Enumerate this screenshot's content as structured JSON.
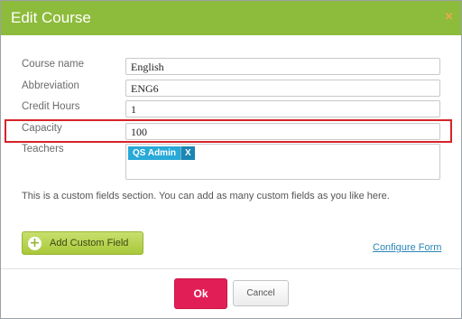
{
  "dialog": {
    "title": "Edit Course",
    "close_glyph": "×"
  },
  "form": {
    "course_name": {
      "label": "Course name",
      "value": "English"
    },
    "abbreviation": {
      "label": "Abbreviation",
      "value": "ENG6"
    },
    "credit_hours": {
      "label": "Credit Hours",
      "value": "1"
    },
    "capacity": {
      "label": "Capacity",
      "value": "100"
    },
    "teachers": {
      "label": "Teachers",
      "chips": [
        {
          "name": "QS Admin",
          "remove": "X"
        }
      ]
    }
  },
  "info_text": "This is a custom fields section. You can add as many custom fields as you like here.",
  "add_custom_field": {
    "label": "Add Custom Field",
    "icon": "plus-icon"
  },
  "configure_form": {
    "label": "Configure Form"
  },
  "footer": {
    "ok_label": "Ok",
    "cancel_label": "Cancel"
  },
  "colors": {
    "header": "#8dbb3b",
    "highlight": "#d6242a",
    "ok": "#e21e57",
    "chip": "#29a9d8"
  }
}
